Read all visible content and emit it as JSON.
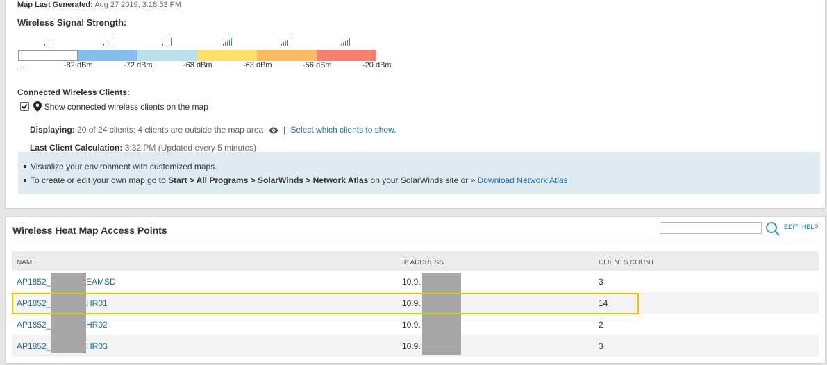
{
  "map": {
    "generated_label": "Map Last Generated:",
    "generated_value": "Aug 27 2019, 3:18:53 PM"
  },
  "signal": {
    "title": "Wireless Signal Strength:",
    "segments": [
      {
        "color": "#ffffff"
      },
      {
        "color": "#84bdec"
      },
      {
        "color": "#b8dfea"
      },
      {
        "color": "#fde06b"
      },
      {
        "color": "#fbb964"
      },
      {
        "color": "#f87f6c"
      }
    ],
    "labels": [
      "...",
      "-82 dBm",
      "-72 dBm",
      "-68 dBm",
      "-63 dBm",
      "-56 dBm",
      "-20 dBm"
    ]
  },
  "clients": {
    "title": "Connected Wireless Clients:",
    "checkbox_label": "Show connected wireless clients on the map",
    "checked": true,
    "displaying_label": "Displaying:",
    "displaying_value": "20 of 24 clients; 4 clients are outside the map area",
    "separator": "|",
    "select_link": "Select which clients to show.",
    "calc_label": "Last Client Calculation:",
    "calc_value": "3:32 PM (Updated every 5 minutes)"
  },
  "info": {
    "line1": "Visualize your environment with customized maps.",
    "line2_prefix": "To create or edit your own map go to ",
    "line2_bold": "Start > All Programs > SolarWinds > Network Atlas",
    "line2_mid": " on your SolarWinds site or » ",
    "line2_link": "Download Network Atlas"
  },
  "ap_panel": {
    "title": "Wireless Heat Map Access Points",
    "search_placeholder": "",
    "edit_label": "EDIT",
    "help_label": "HELP",
    "columns": [
      "NAME",
      "IP ADDRESS",
      "CLIENTS COUNT"
    ],
    "rows": [
      {
        "name_prefix": "AP1852_",
        "name_suffix": "EAMSD",
        "ip": "10.9.",
        "clients": "3"
      },
      {
        "name_prefix": "AP1852_",
        "name_suffix": "HR01",
        "ip": "10.9.",
        "clients": "14"
      },
      {
        "name_prefix": "AP1852_",
        "name_suffix": "HR02",
        "ip": "10.9.",
        "clients": "2"
      },
      {
        "name_prefix": "AP1852_",
        "name_suffix": "HR03",
        "ip": "10.9.",
        "clients": "3"
      }
    ],
    "highlight_color": "#f2c200"
  }
}
